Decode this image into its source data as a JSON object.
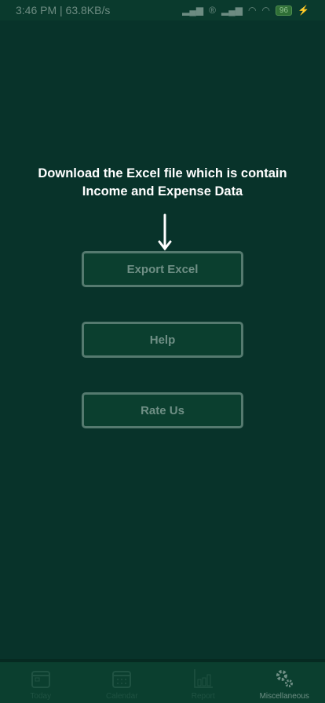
{
  "status_bar": {
    "time": "3:46 PM | 63.8KB/s",
    "battery": "96"
  },
  "hint": {
    "line1": "Download the Excel file which is contain",
    "line2": "Income and Expense Data"
  },
  "buttons": {
    "export": "Export Excel",
    "help": "Help",
    "rate": "Rate Us"
  },
  "nav": [
    {
      "label": "Today",
      "icon": "calendar-day-icon"
    },
    {
      "label": "Calendar",
      "icon": "calendar-icon"
    },
    {
      "label": "Report",
      "icon": "bar-chart-icon"
    },
    {
      "label": "Miscellaneous",
      "icon": "gears-icon",
      "active": true
    }
  ],
  "colors": {
    "background": "#08332a",
    "button": "#0b3f2f",
    "active_nav": "#6f8f85"
  }
}
